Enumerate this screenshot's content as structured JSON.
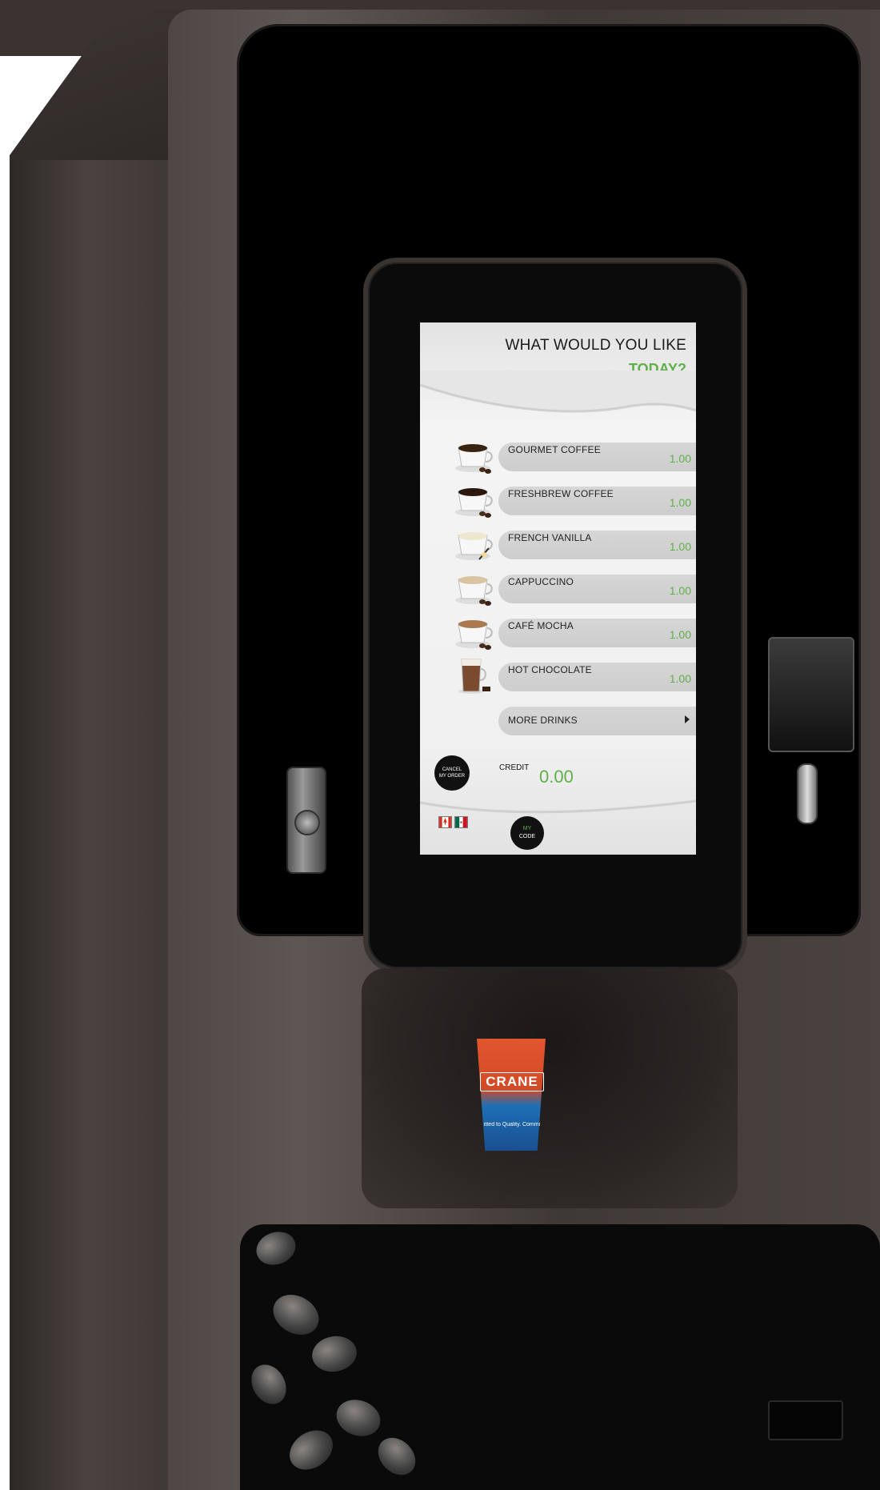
{
  "screen": {
    "header": {
      "line1": "WHAT WOULD YOU LIKE",
      "line2": "TODAY?"
    },
    "menu": [
      {
        "name": "GOURMET COFFEE",
        "price": "1.00",
        "icon": "coffee-cup-icon"
      },
      {
        "name": "FRESHBREW COFFEE",
        "price": "1.00",
        "icon": "coffee-cup-icon"
      },
      {
        "name": "FRENCH VANILLA",
        "price": "1.00",
        "icon": "vanilla-cup-icon"
      },
      {
        "name": "CAPPUCCINO",
        "price": "1.00",
        "icon": "cappuccino-cup-icon"
      },
      {
        "name": "CAFÉ MOCHA",
        "price": "1.00",
        "icon": "mocha-cup-icon"
      },
      {
        "name": "HOT CHOCOLATE",
        "price": "1.00",
        "icon": "hot-chocolate-glass-icon"
      }
    ],
    "more_drinks": "MORE DRINKS",
    "cancel": {
      "line1": "CANCEL",
      "line2": "MY ORDER"
    },
    "credit": {
      "label": "CREDIT",
      "value": "0.00"
    },
    "languages": [
      "canada-flag-icon",
      "mexico-flag-icon"
    ],
    "mycode": {
      "line1": "MY",
      "line2": "CODE"
    }
  },
  "cup": {
    "brand": "CRANE",
    "slogan": "itted to Quality. Commi"
  },
  "colors": {
    "accent_green": "#5fb04a",
    "cup_red": "#d24a26",
    "cup_blue": "#1e6fb5"
  }
}
